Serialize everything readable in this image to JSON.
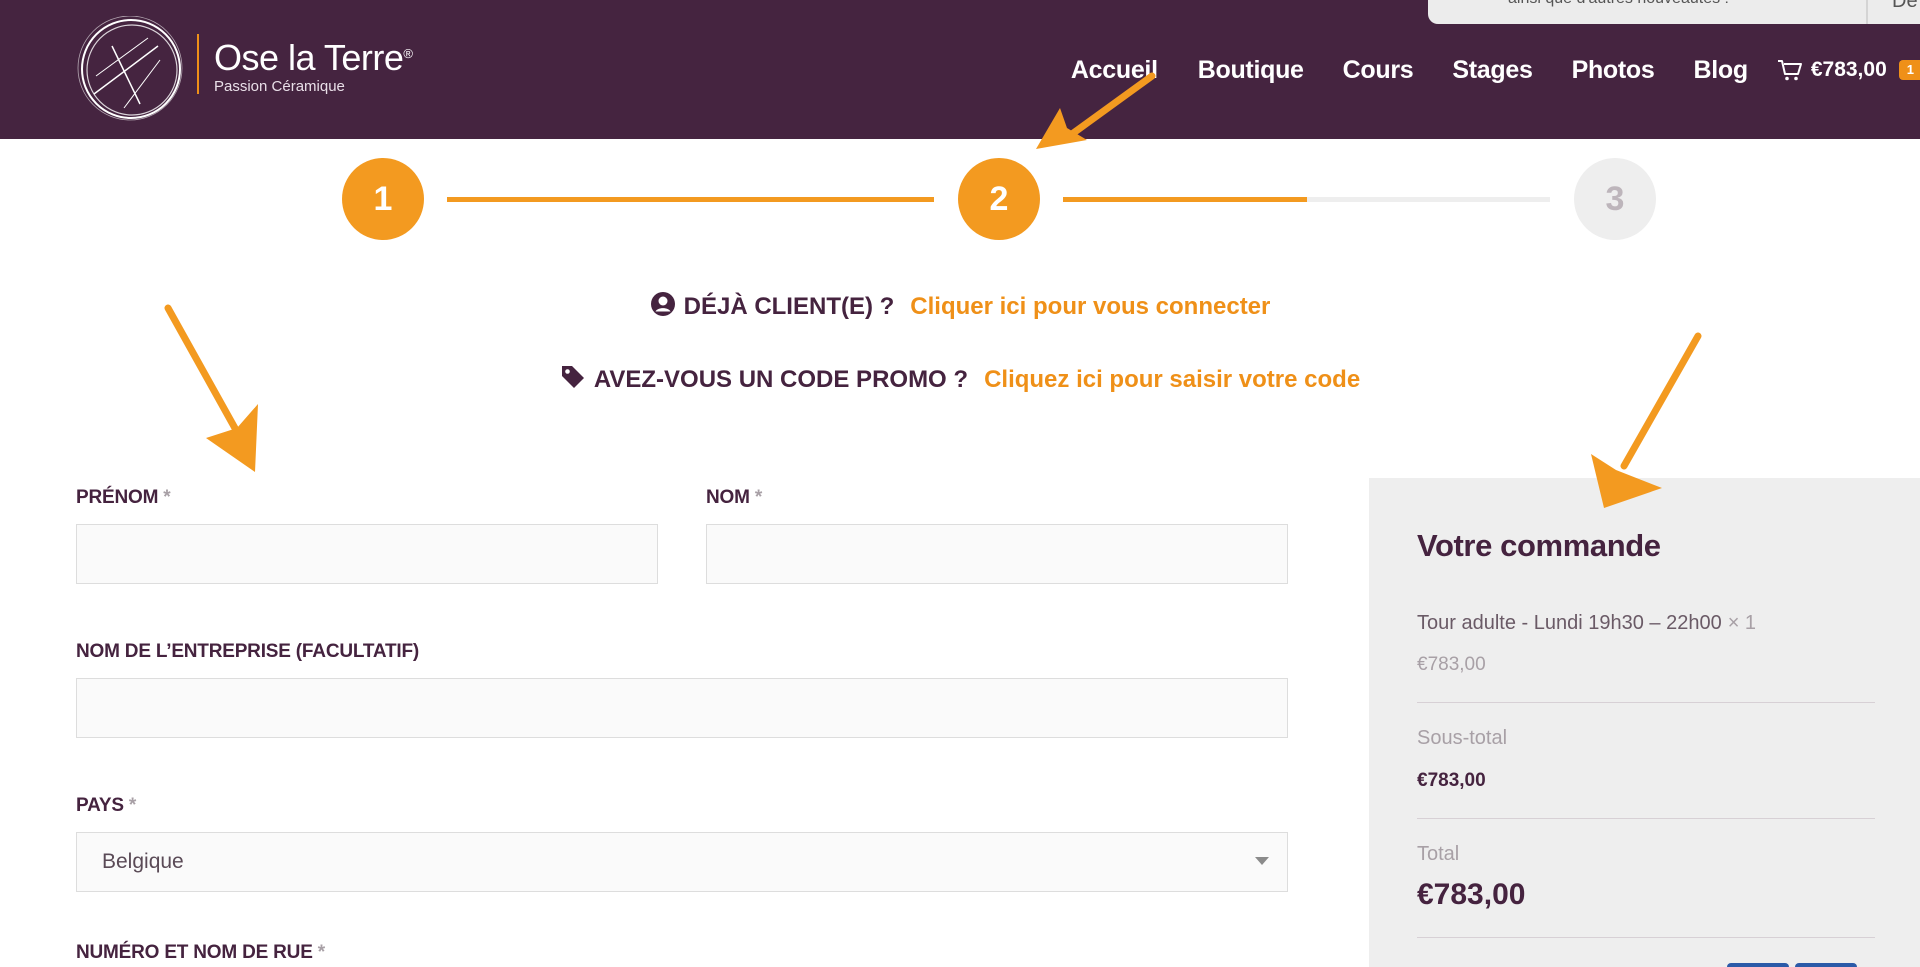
{
  "header": {
    "logo_name": "Ose la Terre",
    "logo_reg": "®",
    "logo_tagline": "Passion Céramique",
    "nav": [
      "Accueil",
      "Boutique",
      "Cours",
      "Stages",
      "Photos",
      "Blog"
    ],
    "cart_total": "€783,00",
    "cart_count": "1"
  },
  "popup": {
    "text": "ainsi que d'autres nouveautés !",
    "button": "De"
  },
  "steps": [
    "1",
    "2",
    "3"
  ],
  "notices": {
    "login_label": "DÉJÀ CLIENT(E) ?",
    "login_link": "Cliquer ici pour vous connecter",
    "promo_label": "AVEZ-VOUS UN CODE PROMO ?",
    "promo_link": "Cliquez ici pour saisir votre code"
  },
  "form": {
    "first_name_label": "PRÉNOM",
    "last_name_label": "NOM",
    "company_label": "NOM DE L’ENTREPRISE (FACULTATIF)",
    "country_label": "PAYS",
    "country_value": "Belgique",
    "street_label": "NUMÉRO ET NOM DE RUE",
    "required_mark": "*"
  },
  "order": {
    "title": "Votre commande",
    "item_name": "Tour adulte - Lundi 19h30 – 22h00",
    "item_qty": "× 1",
    "item_price": "€783,00",
    "subtotal_label": "Sous-total",
    "subtotal_value": "€783,00",
    "total_label": "Total",
    "total_value": "€783,00"
  },
  "colors": {
    "brand_purple": "#452440",
    "accent_orange": "#f39a20"
  },
  "progress": {
    "step_2_line_fill": 0.5
  }
}
